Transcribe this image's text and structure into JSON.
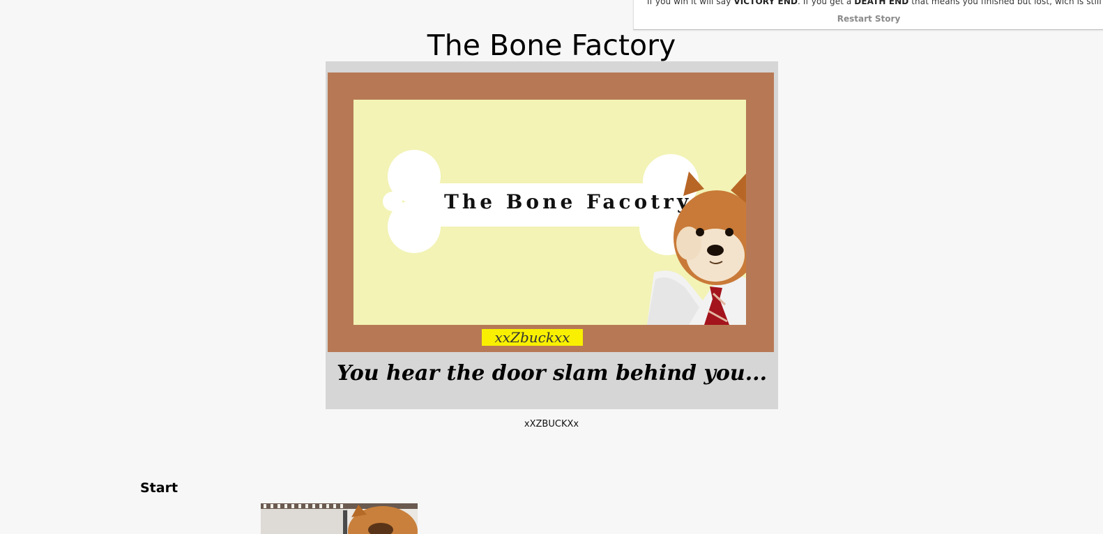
{
  "info_panel": {
    "text_1": "If you win it will say ",
    "victory": "VICTORY END",
    "text_2": ". If you get a ",
    "death": "DEATH END",
    "text_3": " that means you finished but lost, wich is still good.",
    "restart_label": "Restart Story"
  },
  "story": {
    "title": "The Bone Factory",
    "cover": {
      "bone_text": "The Bone Facotry",
      "author_tag": "xxZbuckxx",
      "tagline": "You hear the door slam behind you..."
    },
    "author": "xXZBUCKXx"
  },
  "passage": {
    "heading": "Start"
  },
  "colors": {
    "page_bg": "#f7f7f7",
    "cover_box": "#d6d6d6",
    "frame": "#b77955",
    "inner_bg": "#f2f3b5",
    "author_tag_bg": "#f8f000"
  },
  "icons": {
    "cover_dog": "shiba-dog-in-tie-image",
    "passage_dog": "shiba-dog-photo"
  }
}
